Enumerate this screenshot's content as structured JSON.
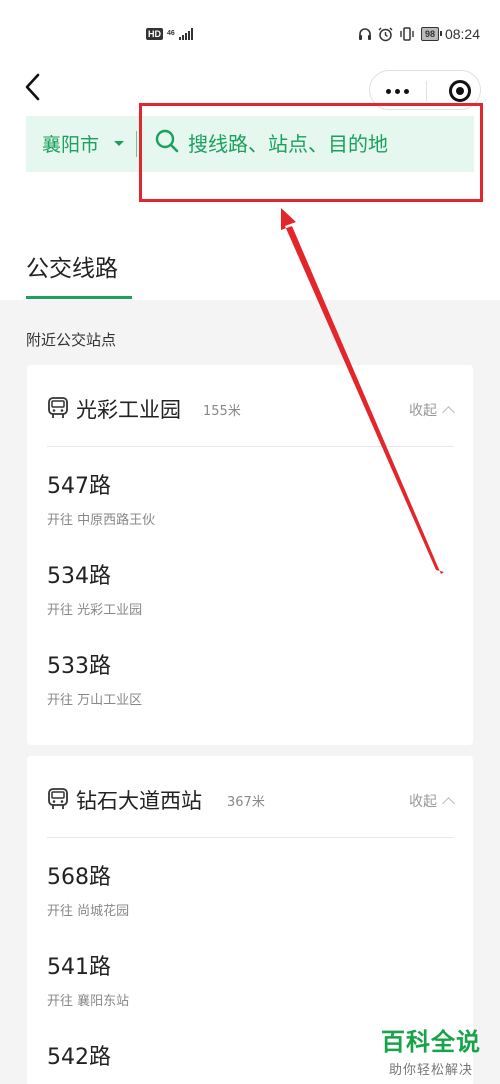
{
  "status_bar": {
    "hd": "HD",
    "network": "46",
    "battery": "98",
    "time": "08:24"
  },
  "header": {
    "city": "襄阳市",
    "search_placeholder": "搜线路、站点、目的地"
  },
  "tabs": [
    {
      "label": "公交线路",
      "active": true
    }
  ],
  "nearby_title": "附近公交站点",
  "stops": [
    {
      "name": "光彩工业园",
      "distance": "155米",
      "collapse_label": "收起",
      "routes": [
        {
          "name": "547路",
          "direction": "开往 中原西路王伙"
        },
        {
          "name": "534路",
          "direction": "开往 光彩工业园"
        },
        {
          "name": "533路",
          "direction": "开往 万山工业区"
        }
      ]
    },
    {
      "name": "钻石大道西站",
      "distance": "367米",
      "collapse_label": "收起",
      "routes": [
        {
          "name": "568路",
          "direction": "开往 尚城花园"
        },
        {
          "name": "541路",
          "direction": "开往 襄阳东站"
        },
        {
          "name": "542路",
          "direction": ""
        }
      ]
    }
  ],
  "watermark": {
    "line1": "百科全说",
    "line2": "助你轻松解决"
  },
  "colors": {
    "accent": "#1ba05e",
    "search_bg": "#e6f7ef",
    "highlight": "#e3262b"
  }
}
